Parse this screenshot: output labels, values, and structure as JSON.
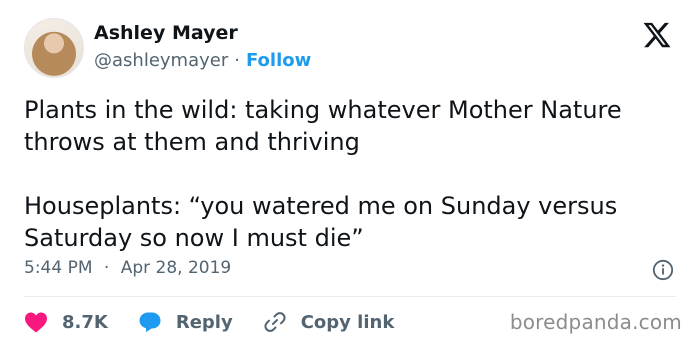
{
  "author": {
    "name": "Ashley Mayer",
    "handle": "@ashleymayer",
    "separator": "·",
    "follow_label": "Follow"
  },
  "tweet": {
    "line1": "Plants in the wild: taking whatever Mother Nature throws at them and thriving",
    "line2": "Houseplants: “you watered me on Sunday versus Saturday so now I must die”",
    "time": "5:44 PM",
    "date_separator": "·",
    "date": "Apr 28, 2019"
  },
  "actions": {
    "likes": "8.7K",
    "reply_label": "Reply",
    "copy_label": "Copy link"
  },
  "watermark": "boredpanda.com",
  "icons": {
    "brand": "x-logo-icon",
    "info": "info-icon",
    "like": "heart-icon",
    "reply": "reply-bubble-icon",
    "copy": "link-icon"
  },
  "colors": {
    "text": "#0f1419",
    "muted": "#536471",
    "link": "#1d9bf0",
    "heart": "#f91880",
    "reply": "#1d9bf0"
  }
}
